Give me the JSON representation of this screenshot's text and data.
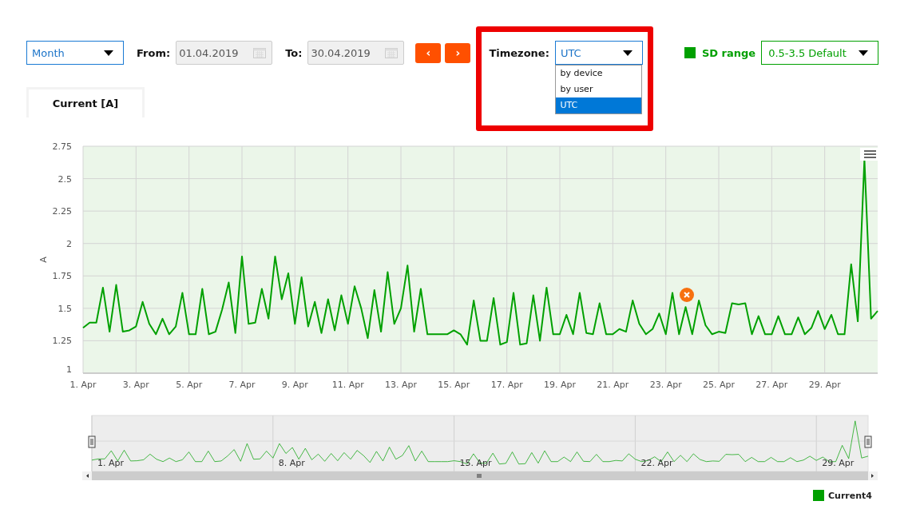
{
  "range_select": {
    "value": "Month"
  },
  "from": {
    "label": "From:",
    "value": "01.04.2019"
  },
  "to": {
    "label": "To:",
    "value": "30.04.2019"
  },
  "nav_buttons": [
    {
      "label": "‹"
    },
    {
      "label": "›"
    }
  ],
  "timezone": {
    "label": "Timezone:",
    "value": "UTC",
    "highlighted": true,
    "expanded": true,
    "options": [
      {
        "label": "by device",
        "selected": false
      },
      {
        "label": "by user",
        "selected": false
      },
      {
        "label": "UTC",
        "selected": true
      }
    ]
  },
  "sd_range": {
    "label": "SD range",
    "value": "0.5-3.5 Default"
  },
  "tabs": [
    {
      "label": "Current [A]",
      "selected": true
    }
  ],
  "chart": {
    "chart_data": {
      "type": "line",
      "ylabel": "A",
      "ylim": [
        1,
        2.75
      ],
      "grid": true,
      "categories": [
        "1. Apr",
        null,
        null,
        null,
        null,
        null,
        null,
        null,
        "3. Apr",
        null,
        null,
        null,
        null,
        null,
        null,
        null,
        "5. Apr",
        null,
        null,
        null,
        null,
        null,
        null,
        null,
        "7. Apr",
        null,
        null,
        null,
        null,
        null,
        null,
        null,
        "9. Apr",
        null,
        null,
        null,
        null,
        null,
        null,
        null,
        "11. Apr",
        null,
        null,
        null,
        null,
        null,
        null,
        null,
        "13. Apr",
        null,
        null,
        null,
        null,
        null,
        null,
        null,
        "15. Apr",
        null,
        null,
        null,
        null,
        null,
        null,
        null,
        "17. Apr",
        null,
        null,
        null,
        null,
        null,
        null,
        null,
        "19. Apr",
        null,
        null,
        null,
        null,
        null,
        null,
        null,
        "21. Apr",
        null,
        null,
        null,
        null,
        null,
        null,
        null,
        "23. Apr",
        null,
        null,
        null,
        null,
        null,
        null,
        null,
        "25. Apr",
        null,
        null,
        null,
        null,
        null,
        null,
        null,
        "27. Apr",
        null,
        null,
        null,
        null,
        null,
        null,
        null,
        "29. Apr",
        null,
        null,
        null,
        null,
        null,
        null,
        null,
        null
      ],
      "yticks": [
        {
          "value": 1,
          "label": "1"
        },
        {
          "value": 1.25,
          "label": "1.25"
        },
        {
          "value": 1.5,
          "label": "1.5"
        },
        {
          "value": 1.75,
          "label": "1.75"
        },
        {
          "value": 2,
          "label": "2"
        },
        {
          "value": 2.25,
          "label": "2.25"
        },
        {
          "value": 2.5,
          "label": "2.5"
        },
        {
          "value": 2.75,
          "label": "2.75"
        }
      ],
      "series": [
        {
          "name": "Current4",
          "color": "#00a000",
          "values": [
            1.35,
            1.39,
            1.39,
            1.66,
            1.32,
            1.68,
            1.32,
            1.33,
            1.36,
            1.55,
            1.38,
            1.3,
            1.42,
            1.3,
            1.36,
            1.62,
            1.3,
            1.3,
            1.65,
            1.3,
            1.32,
            1.49,
            1.7,
            1.31,
            1.9,
            1.38,
            1.39,
            1.65,
            1.42,
            1.9,
            1.57,
            1.77,
            1.38,
            1.74,
            1.36,
            1.55,
            1.31,
            1.57,
            1.33,
            1.6,
            1.38,
            1.67,
            1.5,
            1.27,
            1.64,
            1.32,
            1.78,
            1.38,
            1.5,
            1.83,
            1.32,
            1.65,
            1.3,
            1.3,
            1.3,
            1.3,
            1.33,
            1.3,
            1.22,
            1.56,
            1.25,
            1.25,
            1.58,
            1.22,
            1.24,
            1.62,
            1.22,
            1.23,
            1.6,
            1.25,
            1.66,
            1.3,
            1.3,
            1.45,
            1.3,
            1.62,
            1.31,
            1.3,
            1.54,
            1.3,
            1.3,
            1.34,
            1.32,
            1.56,
            1.38,
            1.3,
            1.34,
            1.46,
            1.3,
            1.62,
            1.3,
            1.51,
            1.3,
            1.56,
            1.37,
            1.3,
            1.32,
            1.31,
            1.54,
            1.53,
            1.54,
            1.3,
            1.44,
            1.3,
            1.3,
            1.44,
            1.3,
            1.3,
            1.43,
            1.3,
            1.35,
            1.48,
            1.34,
            1.45,
            1.3,
            1.3,
            1.84,
            1.4,
            2.65,
            1.42,
            1.48
          ]
        }
      ]
    }
  },
  "navigator": {
    "labels": [
      "1. Apr",
      "8. Apr",
      "15. Apr",
      "22. Apr",
      "29. Apr"
    ]
  }
}
